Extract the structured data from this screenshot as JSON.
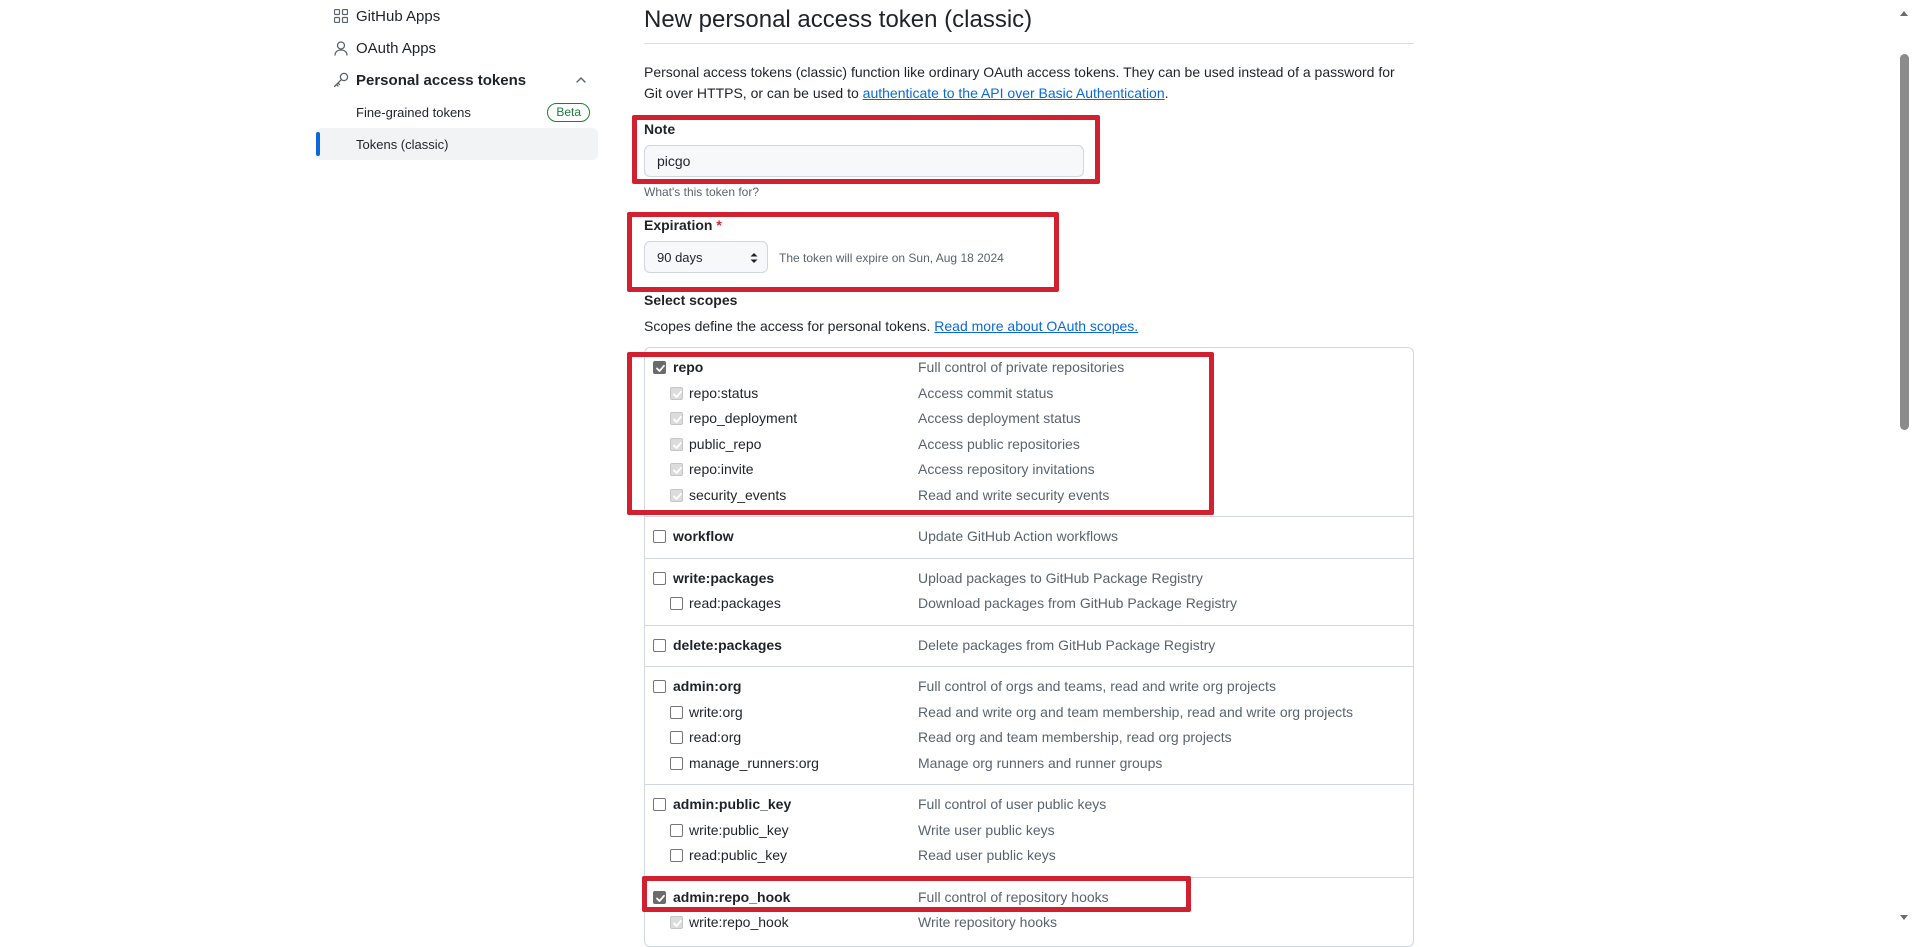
{
  "sidebar": {
    "items": [
      {
        "label": "GitHub Apps",
        "icon": "apps-grid-icon"
      },
      {
        "label": "OAuth Apps",
        "icon": "person-icon"
      },
      {
        "label": "Personal access tokens",
        "icon": "key-icon"
      }
    ],
    "subitems": [
      {
        "label": "Fine-grained tokens",
        "badge": "Beta"
      },
      {
        "label": "Tokens (classic)",
        "active": true
      }
    ]
  },
  "page": {
    "title": "New personal access token (classic)",
    "intro_text": "Personal access tokens (classic) function like ordinary OAuth access tokens. They can be used instead of a password for Git over HTTPS, or can be used to ",
    "intro_link": "authenticate to the API over Basic Authentication",
    "intro_end": "."
  },
  "note": {
    "label": "Note",
    "value": "picgo",
    "help": "What's this token for?"
  },
  "expiration": {
    "label": "Expiration",
    "required_mark": "*",
    "selected": "90 days",
    "note": "The token will expire on Sun, Aug 18 2024"
  },
  "scopes": {
    "label": "Select scopes",
    "desc_text": "Scopes define the access for personal tokens. ",
    "desc_link": "Read more about OAuth scopes.",
    "groups": [
      {
        "rows": [
          {
            "name": "repo",
            "desc": "Full control of private repositories",
            "state": "checked",
            "level": "top"
          },
          {
            "name": "repo:status",
            "desc": "Access commit status",
            "state": "checked-dim",
            "level": "sub"
          },
          {
            "name": "repo_deployment",
            "desc": "Access deployment status",
            "state": "checked-dim",
            "level": "sub"
          },
          {
            "name": "public_repo",
            "desc": "Access public repositories",
            "state": "checked-dim",
            "level": "sub"
          },
          {
            "name": "repo:invite",
            "desc": "Access repository invitations",
            "state": "checked-dim",
            "level": "sub"
          },
          {
            "name": "security_events",
            "desc": "Read and write security events",
            "state": "checked-dim",
            "level": "sub"
          }
        ]
      },
      {
        "rows": [
          {
            "name": "workflow",
            "desc": "Update GitHub Action workflows",
            "state": "unchecked",
            "level": "top"
          }
        ]
      },
      {
        "rows": [
          {
            "name": "write:packages",
            "desc": "Upload packages to GitHub Package Registry",
            "state": "unchecked",
            "level": "top"
          },
          {
            "name": "read:packages",
            "desc": "Download packages from GitHub Package Registry",
            "state": "unchecked",
            "level": "sub"
          }
        ]
      },
      {
        "rows": [
          {
            "name": "delete:packages",
            "desc": "Delete packages from GitHub Package Registry",
            "state": "unchecked",
            "level": "top"
          }
        ]
      },
      {
        "rows": [
          {
            "name": "admin:org",
            "desc": "Full control of orgs and teams, read and write org projects",
            "state": "unchecked",
            "level": "top"
          },
          {
            "name": "write:org",
            "desc": "Read and write org and team membership, read and write org projects",
            "state": "unchecked",
            "level": "sub"
          },
          {
            "name": "read:org",
            "desc": "Read org and team membership, read org projects",
            "state": "unchecked",
            "level": "sub"
          },
          {
            "name": "manage_runners:org",
            "desc": "Manage org runners and runner groups",
            "state": "unchecked",
            "level": "sub"
          }
        ]
      },
      {
        "rows": [
          {
            "name": "admin:public_key",
            "desc": "Full control of user public keys",
            "state": "unchecked",
            "level": "top"
          },
          {
            "name": "write:public_key",
            "desc": "Write user public keys",
            "state": "unchecked",
            "level": "sub"
          },
          {
            "name": "read:public_key",
            "desc": "Read user public keys",
            "state": "unchecked",
            "level": "sub"
          }
        ]
      },
      {
        "rows": [
          {
            "name": "admin:repo_hook",
            "desc": "Full control of repository hooks",
            "state": "checked",
            "level": "top"
          },
          {
            "name": "write:repo_hook",
            "desc": "Write repository hooks",
            "state": "checked-dim",
            "level": "sub"
          }
        ]
      }
    ]
  },
  "colors": {
    "annotation": "#d1202f",
    "link": "#0969da",
    "beta": "#1a7f37",
    "active_indicator": "#0969da"
  }
}
